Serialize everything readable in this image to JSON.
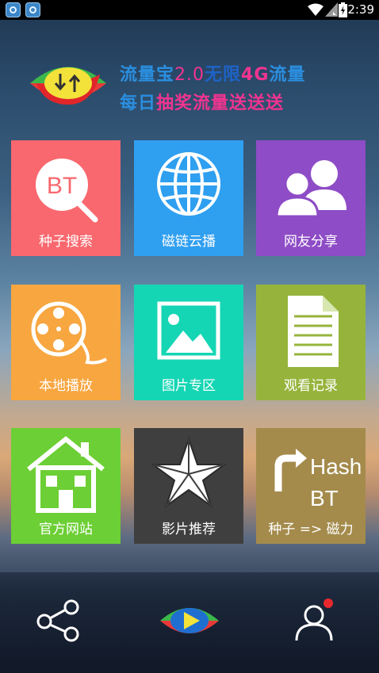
{
  "status_bar": {
    "time": "2:39"
  },
  "banner": {
    "line1": {
      "part1": "流量宝",
      "part2": "2.0",
      "part3": "无限",
      "part4": "4G",
      "part5": "流量"
    },
    "line2": {
      "part1": "每日",
      "part2": "抽奖流量",
      "part3": "送送送"
    }
  },
  "tiles": [
    {
      "label": "种子搜索",
      "color": "#f8686e",
      "icon_text": "BT"
    },
    {
      "label": "磁链云播",
      "color": "#2f9ff0"
    },
    {
      "label": "网友分享",
      "color": "#8e4cc6"
    },
    {
      "label": "本地播放",
      "color": "#f7a640"
    },
    {
      "label": "图片专区",
      "color": "#15d6b4"
    },
    {
      "label": "观看记录",
      "color": "#96b43c"
    },
    {
      "label": "官方网站",
      "color": "#6ccf35"
    },
    {
      "label": "影片推荐",
      "color": "#3f3f3f"
    },
    {
      "label": "种子 => 磁力",
      "color": "#a48b4c",
      "icon_text_1": "Hash",
      "icon_text_2": "BT"
    }
  ],
  "bottom_bar": {
    "items": [
      "share",
      "play",
      "profile"
    ]
  }
}
